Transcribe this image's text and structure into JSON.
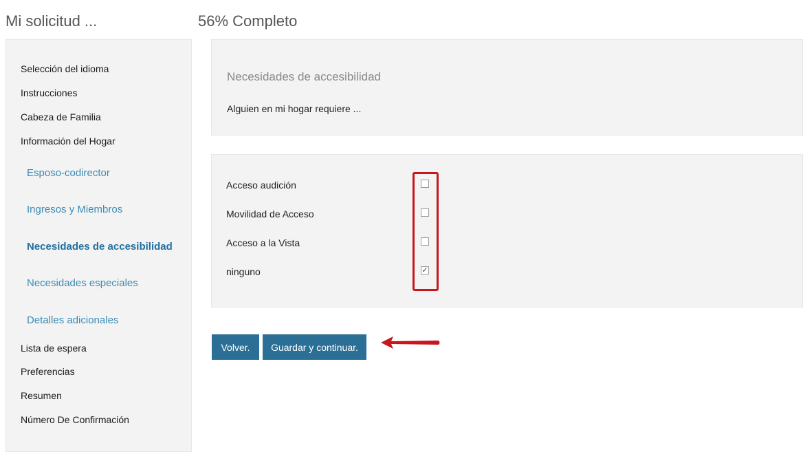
{
  "header": {
    "title": "Mi solicitud ...",
    "progress": "56% Completo"
  },
  "sidebar": {
    "items": [
      {
        "label": "Selección del idioma"
      },
      {
        "label": "Instrucciones"
      },
      {
        "label": "Cabeza de Familia"
      },
      {
        "label": "Información del Hogar"
      },
      {
        "label": "Esposo-codirector"
      },
      {
        "label": "Ingresos y Miembros"
      },
      {
        "label": "Necesidades de accesibilidad"
      },
      {
        "label": "Necesidades especiales"
      },
      {
        "label": "Detalles adicionales"
      },
      {
        "label": "Lista de espera"
      },
      {
        "label": "Preferencias"
      },
      {
        "label": "Resumen"
      },
      {
        "label": "Número De Confirmación"
      }
    ]
  },
  "main": {
    "section_title": "Necesidades de accesibilidad",
    "section_subtitle": "Alguien en mi hogar requiere ...",
    "options": [
      {
        "label": "Acceso audición",
        "checked": false
      },
      {
        "label": "Movilidad de Acceso",
        "checked": false
      },
      {
        "label": "Acceso a la Vista",
        "checked": false
      },
      {
        "label": "ninguno",
        "checked": true
      }
    ]
  },
  "buttons": {
    "back_label": "Volver.",
    "save_label": "Guardar y continuar."
  },
  "colors": {
    "primary_button": "#2b6f96",
    "link": "#3a8bb5",
    "highlight": "#c8161d",
    "panel": "#f3f3f3"
  }
}
